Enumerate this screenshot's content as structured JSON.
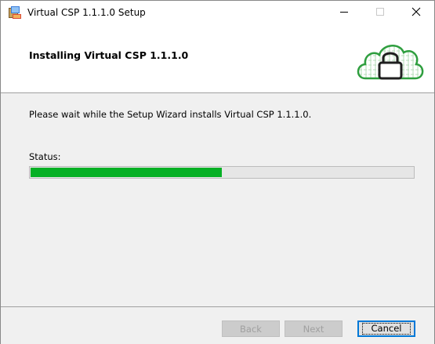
{
  "window": {
    "title": "Virtual CSP 1.1.1.0 Setup"
  },
  "titlebar_buttons": {
    "minimize_icon": "minimize-icon",
    "maximize_icon": "maximize-icon",
    "close_icon": "close-icon"
  },
  "header": {
    "title": "Installing Virtual CSP 1.1.1.0",
    "logo_icon": "cloud-lock-icon",
    "logo_color": "#2e9e3e"
  },
  "content": {
    "message": "Please wait while the Setup Wizard installs Virtual CSP 1.1.1.0.",
    "status_label": "Status:",
    "progress_fraction": 0.5,
    "progress_color": "#06b025"
  },
  "footer": {
    "back_label": "Back",
    "next_label": "Next",
    "cancel_label": "Cancel"
  }
}
